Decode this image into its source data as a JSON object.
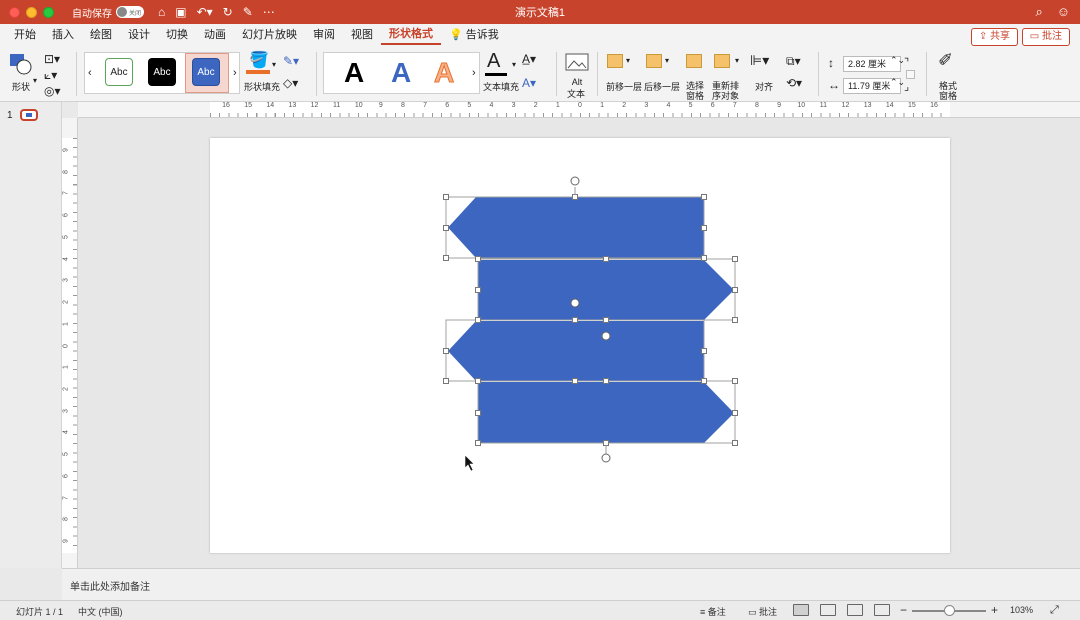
{
  "titlebar": {
    "autosave_label": "自动保存",
    "autosave_state": "关闭",
    "doc_title": "演示文稿1",
    "search_icon": "search-icon",
    "account_icon": "smiley-icon"
  },
  "tabs": [
    {
      "label": "开始"
    },
    {
      "label": "插入"
    },
    {
      "label": "绘图"
    },
    {
      "label": "设计"
    },
    {
      "label": "切换"
    },
    {
      "label": "动画"
    },
    {
      "label": "幻灯片放映"
    },
    {
      "label": "审阅"
    },
    {
      "label": "视图"
    },
    {
      "label": "形状格式",
      "active": true
    },
    {
      "label": "告诉我"
    }
  ],
  "share": {
    "label": "共享"
  },
  "comment": {
    "label": "批注"
  },
  "ribbon": {
    "shape_label": "形状",
    "style_preview_text": "Abc",
    "shape_fill_label": "形状填充",
    "text_fill_label": "文本填充",
    "wordart_letter": "A",
    "alt_text_line1": "Alt",
    "alt_text_line2": "文本",
    "bring_forward": "前移一层",
    "send_backward": "后移一层",
    "selection_pane_l1": "选择",
    "selection_pane_l2": "窗格",
    "reorder_l1": "重新排",
    "reorder_l2": "序对象",
    "align": "对齐",
    "height_value": "2.82 厘米",
    "width_value": "11.79 厘米",
    "format_pane_l1": "格式",
    "format_pane_l2": "窗格"
  },
  "colors": {
    "accent": "#c8432b",
    "shape_fill": "#3d66c0",
    "fill_swatch": "#e8702a"
  },
  "slides_panel": {
    "number": "1"
  },
  "ruler_h_labels": [
    "16",
    "15",
    "14",
    "13",
    "12",
    "11",
    "10",
    "9",
    "8",
    "7",
    "6",
    "5",
    "4",
    "3",
    "2",
    "1",
    "0",
    "1",
    "2",
    "3",
    "4",
    "5",
    "6",
    "7",
    "8",
    "9",
    "10",
    "11",
    "12",
    "13",
    "14",
    "15",
    "16"
  ],
  "ruler_v_labels": [
    "9",
    "8",
    "7",
    "6",
    "5",
    "4",
    "3",
    "2",
    "1",
    "0",
    "1",
    "2",
    "3",
    "4",
    "5",
    "6",
    "7",
    "8",
    "9"
  ],
  "notes": {
    "placeholder": "单击此处添加备注"
  },
  "status": {
    "slide_info": "幻灯片 1 / 1",
    "language": "中文 (中国)",
    "notes_btn": "备注",
    "comments_btn": "批注",
    "zoom_minus": "−",
    "zoom_plus": "+",
    "zoom": "103%"
  }
}
